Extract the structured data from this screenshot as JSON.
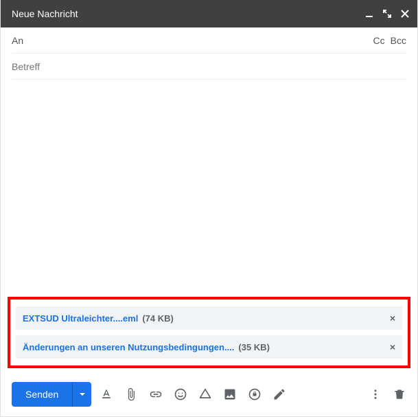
{
  "window": {
    "title": "Neue Nachricht"
  },
  "fields": {
    "to_label": "An",
    "cc_label": "Cc",
    "bcc_label": "Bcc",
    "subject_placeholder": "Betreff"
  },
  "attachments": [
    {
      "name": "EXTSUD Ultraleichter....eml",
      "size": "(74 KB)"
    },
    {
      "name": "Änderungen an unseren Nutzungsbedingungen....",
      "size": "(35 KB)"
    }
  ],
  "footer": {
    "send_label": "Senden"
  },
  "icons": {
    "minimize": "minimize",
    "expand": "expand",
    "close": "close",
    "text_format": "A",
    "attach": "attach",
    "link": "link",
    "emoji": "emoji",
    "drive": "drive",
    "image": "image",
    "confidential": "confidential",
    "pen": "pen",
    "more": "more",
    "trash": "trash"
  }
}
